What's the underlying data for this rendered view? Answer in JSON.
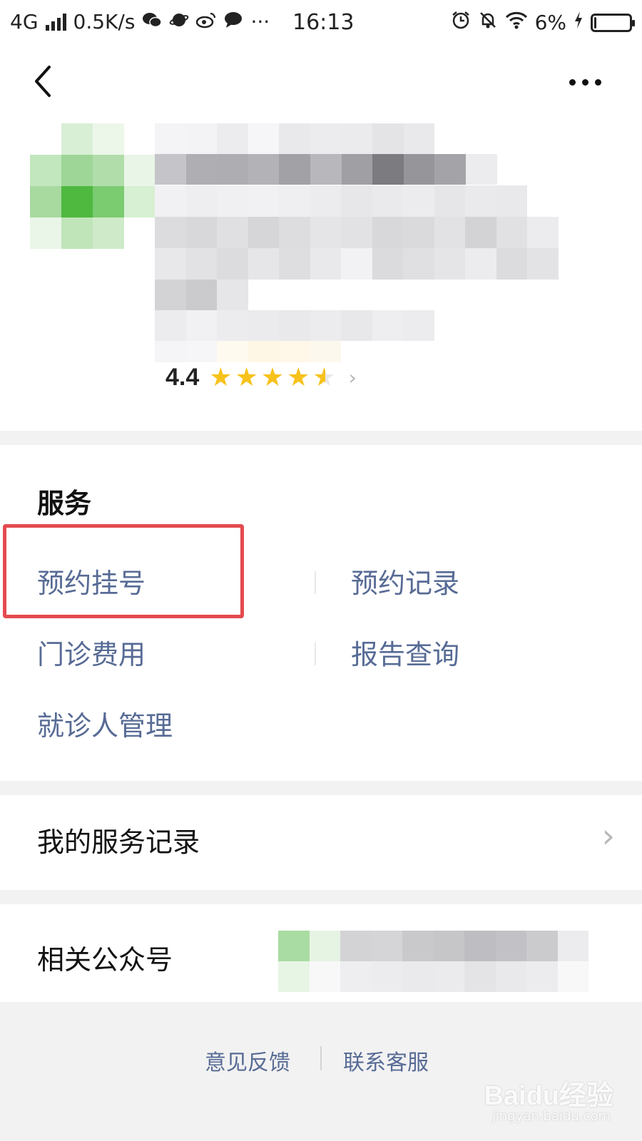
{
  "status_bar": {
    "network": "4G",
    "speed": "0.5K/s",
    "more": "···",
    "time": "16:13",
    "battery": "6%",
    "battery_level": 0.06,
    "icons": [
      "wechat-icon",
      "planet-icon",
      "weibo-icon",
      "chat-bubble-icon",
      "alarm-icon",
      "bell-off-icon",
      "wifi-icon",
      "charging-icon",
      "battery-icon"
    ]
  },
  "nav": {
    "back_icon": "chevron-left-icon",
    "more_icon": "more-dots-icon"
  },
  "profile": {
    "rating_score": "4.4",
    "rating_value": 4.4,
    "rating_max": 5,
    "chevron": "›"
  },
  "services": {
    "title": "服务",
    "items": [
      {
        "label": "预约挂号"
      },
      {
        "label": "预约记录"
      },
      {
        "label": "门诊费用"
      },
      {
        "label": "报告查询"
      },
      {
        "label": "就诊人管理"
      }
    ]
  },
  "service_record": {
    "label": "我的服务记录",
    "chevron": "›"
  },
  "official_accounts": {
    "label": "相关公众号"
  },
  "footer": {
    "feedback": "意见反馈",
    "contact": "联系客服"
  },
  "watermark": {
    "brand": "Baidu经验",
    "url": "jingyan.baidu.com"
  },
  "colors": {
    "link": "#576b95",
    "star": "#f7c21b",
    "highlight": "#e44a4f",
    "divider": "#f2f2f2"
  }
}
